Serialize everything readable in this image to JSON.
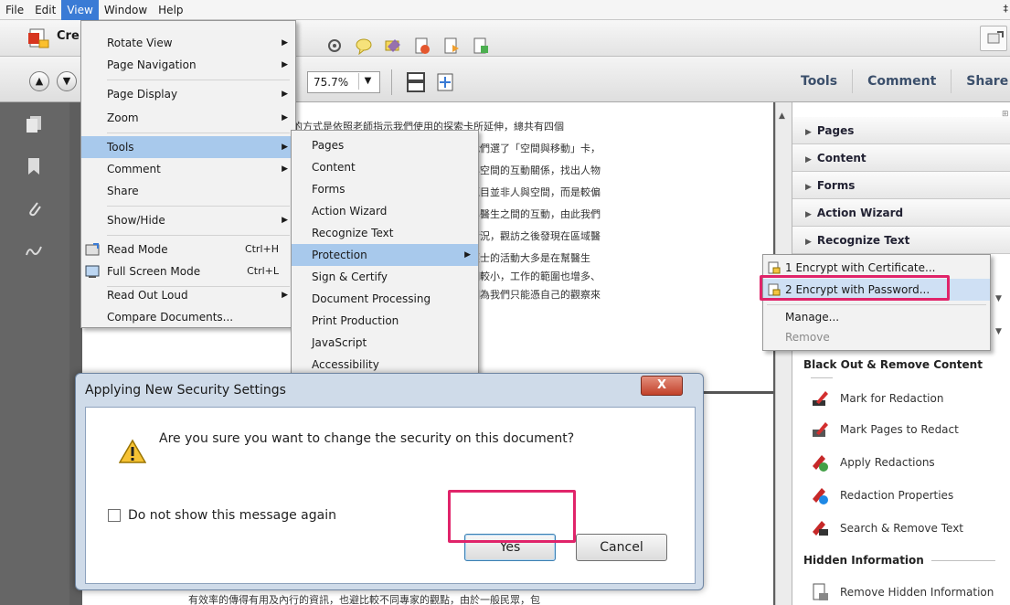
{
  "menubar": {
    "items": [
      "File",
      "Edit",
      "View",
      "Window",
      "Help"
    ],
    "active": "View"
  },
  "toolbar": {
    "create_label": "Cre",
    "zoom_value": "75.7%",
    "right_tabs": [
      "Tools",
      "Comment",
      "Share"
    ]
  },
  "view_menu": {
    "items": [
      {
        "label": "Rotate View",
        "submenu": true
      },
      {
        "label": "Page Navigation",
        "submenu": true
      },
      {
        "label": "Page Display",
        "submenu": true
      },
      {
        "label": "Zoom",
        "submenu": true
      },
      {
        "label": "Tools",
        "submenu": true,
        "highlighted": true
      },
      {
        "label": "Comment",
        "submenu": true
      },
      {
        "label": "Share",
        "submenu": false
      },
      {
        "label": "Show/Hide",
        "submenu": true
      },
      {
        "label": "Read Mode",
        "shortcut": "Ctrl+H"
      },
      {
        "label": "Full Screen Mode",
        "shortcut": "Ctrl+L"
      },
      {
        "label": "Read Out Loud",
        "submenu": true
      },
      {
        "label": "Compare Documents..."
      }
    ]
  },
  "tools_menu": {
    "items": [
      "Pages",
      "Content",
      "Forms",
      "Action Wizard",
      "Recognize Text",
      "Protection",
      "Sign & Certify",
      "Document Processing",
      "Print Production",
      "JavaScript",
      "Accessibility"
    ],
    "highlighted": "Protection"
  },
  "protection_menu": {
    "items": [
      {
        "label": "1 Encrypt with Certificate..."
      },
      {
        "label": "2 Encrypt with Password...",
        "highlighted": true
      },
      {
        "label": "Manage..."
      },
      {
        "label": "Remove",
        "disabled": true
      }
    ]
  },
  "right_panel": {
    "groups": [
      "Pages",
      "Content",
      "Forms",
      "Action Wizard",
      "Recognize Text"
    ],
    "section_black_out": "Black Out & Remove Content",
    "black_out_items": [
      "Mark for Redaction",
      "Mark Pages to Redact",
      "Apply Redactions",
      "Redaction Properties",
      "Search & Remove Text"
    ],
    "section_hidden": "Hidden Information",
    "hidden_items": [
      "Remove Hidden Information"
    ]
  },
  "document": {
    "lines": [
      "的方式是依照老師指示我們使用的探索卡所延伸，總共有四個",
      "我們選了「空間與移動」卡，",
      "與空間的互動關係，找出人物",
      "題目並非人與空間，而是較偏",
      "與醫生之間的互動，由此我們",
      "情況，觀訪之後發現在區域醫",
      "護士的活動大多是在幫醫生",
      "相較小，工作的範圍也增多、",
      "因為我們只能憑自己的觀察來"
    ],
    "bottom_line": "有效率的傳得有用及內行的資訊，也避比較不同專家的觀點，由於一般民眾，包"
  },
  "dialog": {
    "title": "Applying New Security Settings",
    "close_label": "X",
    "message": "Are you sure you want to change the security on this document?",
    "checkbox_label": "Do not show this message again",
    "yes_label": "Yes",
    "cancel_label": "Cancel"
  },
  "colors": {
    "highlight_box": "#e0246a",
    "menu_highlight": "#a8c9ec",
    "title_accent": "#3a7bd5"
  }
}
